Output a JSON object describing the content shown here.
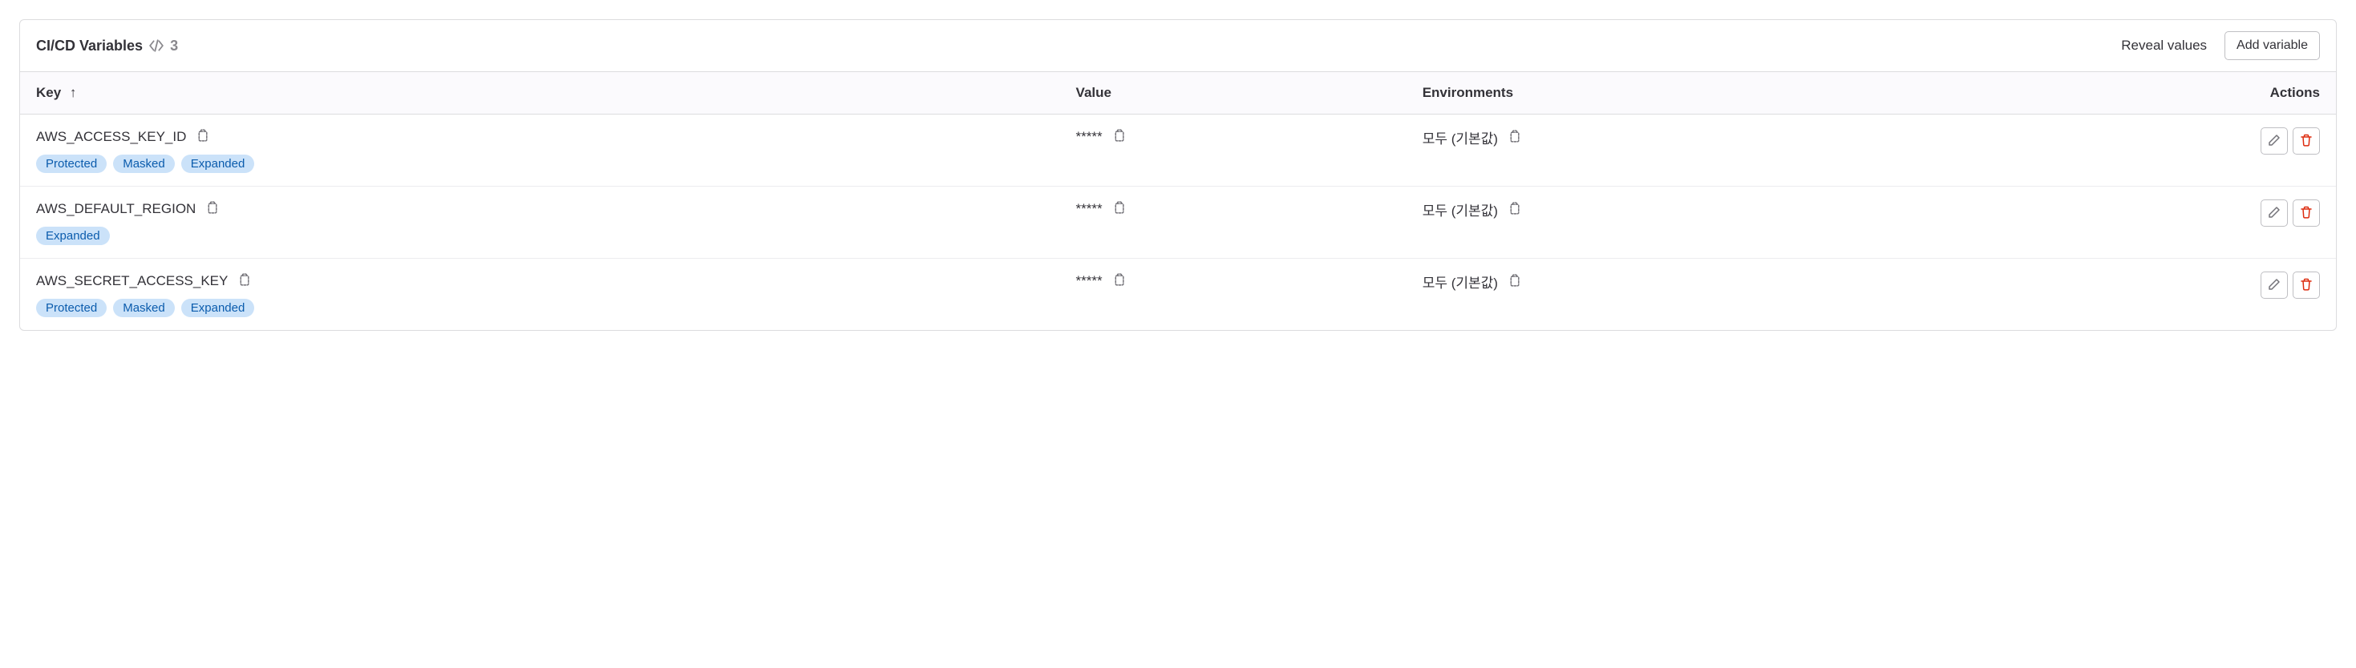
{
  "header": {
    "title": "CI/CD Variables",
    "count": "3",
    "reveal_label": "Reveal values",
    "add_label": "Add variable"
  },
  "columns": {
    "key": "Key",
    "value": "Value",
    "environments": "Environments",
    "actions": "Actions"
  },
  "badges": {
    "protected": "Protected",
    "masked": "Masked",
    "expanded": "Expanded"
  },
  "rows": [
    {
      "key": "AWS_ACCESS_KEY_ID",
      "value": "*****",
      "environments": "모두 (기본값)",
      "badges": [
        "protected",
        "masked",
        "expanded"
      ]
    },
    {
      "key": "AWS_DEFAULT_REGION",
      "value": "*****",
      "environments": "모두 (기본값)",
      "badges": [
        "expanded"
      ]
    },
    {
      "key": "AWS_SECRET_ACCESS_KEY",
      "value": "*****",
      "environments": "모두 (기본값)",
      "badges": [
        "protected",
        "masked",
        "expanded"
      ]
    }
  ]
}
